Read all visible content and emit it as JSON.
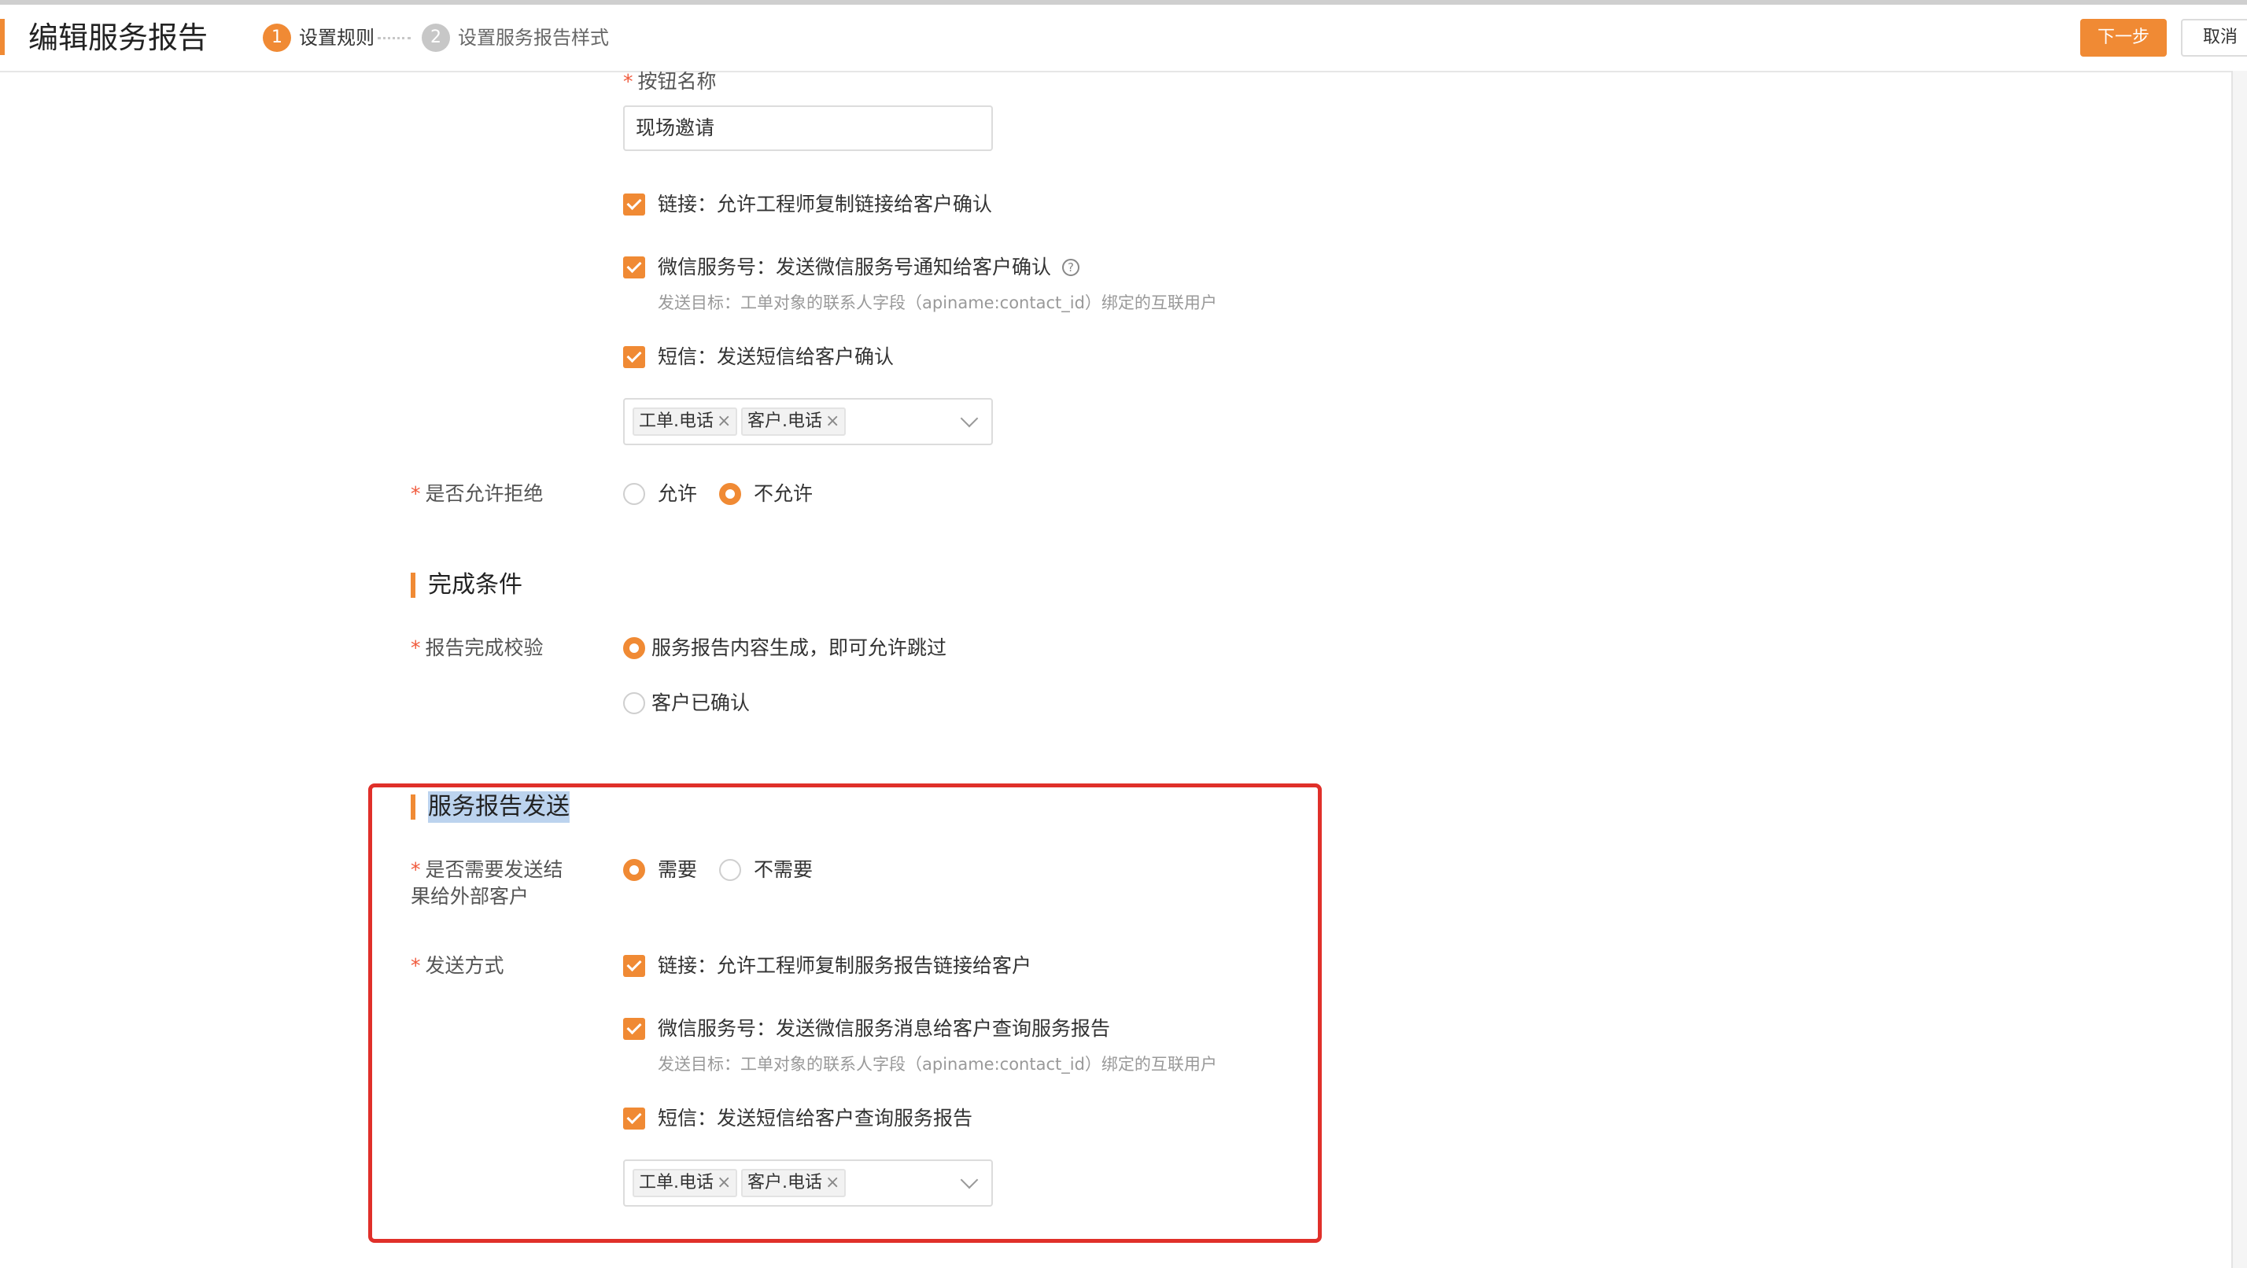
{
  "header": {
    "title": "编辑服务报告",
    "steps": [
      {
        "num": "1",
        "label": "设置规则"
      },
      {
        "num": "2",
        "label": "设置服务报告样式"
      }
    ],
    "next_label": "下一步",
    "cancel_label": "取消"
  },
  "confirm": {
    "button_name_label": "按钮名称",
    "button_name_value": "现场邀请",
    "options": [
      {
        "label": "链接：允许工程师复制链接给客户确认",
        "checked": true
      },
      {
        "label": "微信服务号：发送微信服务号通知给客户确认",
        "checked": true,
        "hint": "发送目标：工单对象的联系人字段（apiname:contact_id）绑定的互联用户"
      },
      {
        "label": "短信：发送短信给客户确认",
        "checked": true
      }
    ],
    "sms_tags": [
      "工单.电话",
      "客户.电话"
    ],
    "reject_label": "是否允许拒绝",
    "reject_options": [
      "允许",
      "不允许"
    ],
    "reject_selected": "不允许"
  },
  "completion": {
    "section_title": "完成条件",
    "check_label": "报告完成校验",
    "check_options": [
      "服务报告内容生成，即可允许跳过",
      "客户已确认"
    ],
    "check_selected": "服务报告内容生成，即可允许跳过"
  },
  "sending": {
    "section_title": "服务报告发送",
    "need_label_line1": "是否需要发送结",
    "need_label_line2": "果给外部客户",
    "need_options": [
      "需要",
      "不需要"
    ],
    "need_selected": "需要",
    "method_label": "发送方式",
    "methods": [
      {
        "label": "链接：允许工程师复制服务报告链接给客户",
        "checked": true
      },
      {
        "label": "微信服务号：发送微信服务消息给客户查询服务报告",
        "checked": true,
        "hint": "发送目标：工单对象的联系人字段（apiname:contact_id）绑定的互联用户"
      },
      {
        "label": "短信：发送短信给客户查询服务报告",
        "checked": true
      }
    ],
    "sms_tags": [
      "工单.电话",
      "客户.电话"
    ]
  },
  "colors": {
    "accent": "#f08a34",
    "highlight_box": "#e0302a",
    "selection": "#bcd3ee"
  }
}
